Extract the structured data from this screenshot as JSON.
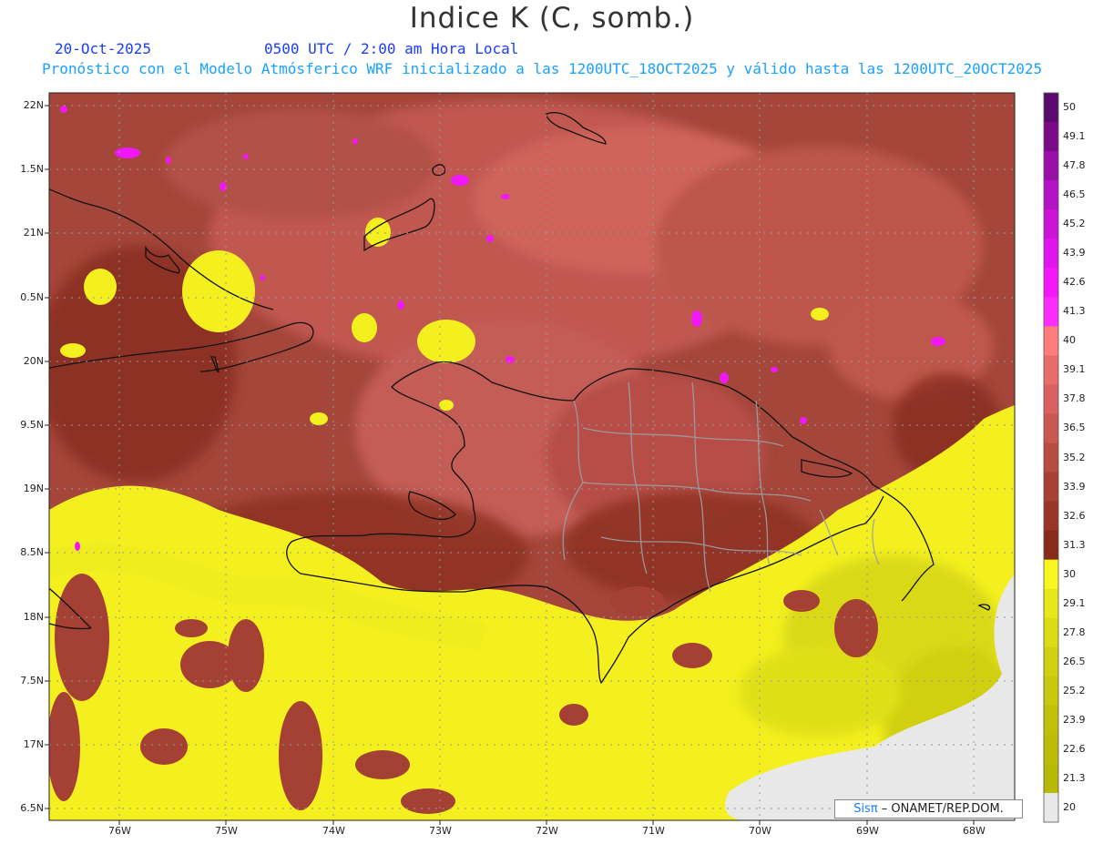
{
  "header": {
    "title": "Indice K (C, somb.)",
    "date": "20-Oct-2025",
    "time": "0500 UTC / 2:00 am Hora Local",
    "subtitle": "Pronóstico con el Modelo Atmósferico WRF inicializado a las 1200UTC_18OCT2025 y válido hasta las  1200UTC_20OCT2025"
  },
  "map": {
    "lat_labels": [
      "22N",
      "1.5N",
      "21N",
      "0.5N",
      "20N",
      "9.5N",
      "19N",
      "8.5N",
      "18N",
      "7.5N",
      "17N",
      "6.5N"
    ],
    "lon_labels": [
      "76W",
      "75W",
      "74W",
      "73W",
      "72W",
      "71W",
      "70W",
      "69W",
      "68W"
    ]
  },
  "colorbar": {
    "labels": [
      "50",
      "49.1",
      "47.8",
      "46.5",
      "45.2",
      "43.9",
      "42.6",
      "41.3",
      "40",
      "39.1",
      "37.8",
      "36.5",
      "35.2",
      "33.9",
      "32.6",
      "31.3",
      "30",
      "29.1",
      "27.8",
      "26.5",
      "25.2",
      "23.9",
      "22.6",
      "21.3",
      "20"
    ],
    "colors": [
      "#5a0a6e",
      "#7a0a88",
      "#9810a8",
      "#b414c4",
      "#cc14d8",
      "#e014ec",
      "#f218f8",
      "#ff2cff",
      "#ff7c7c",
      "#e86c6c",
      "#d86060",
      "#c85850",
      "#b84c40",
      "#a84034",
      "#983428",
      "#882a1c",
      "#f8f820",
      "#e8e818",
      "#dcdc14",
      "#d0d010",
      "#c8c80c",
      "#c0c00a",
      "#bcbc08",
      "#b8b806",
      "#e8e8e8"
    ],
    "colors_meaning": "top to bottom"
  },
  "credit": {
    "sis": "Sisπ",
    "org": " – ONAMET/REP.DOM."
  }
}
